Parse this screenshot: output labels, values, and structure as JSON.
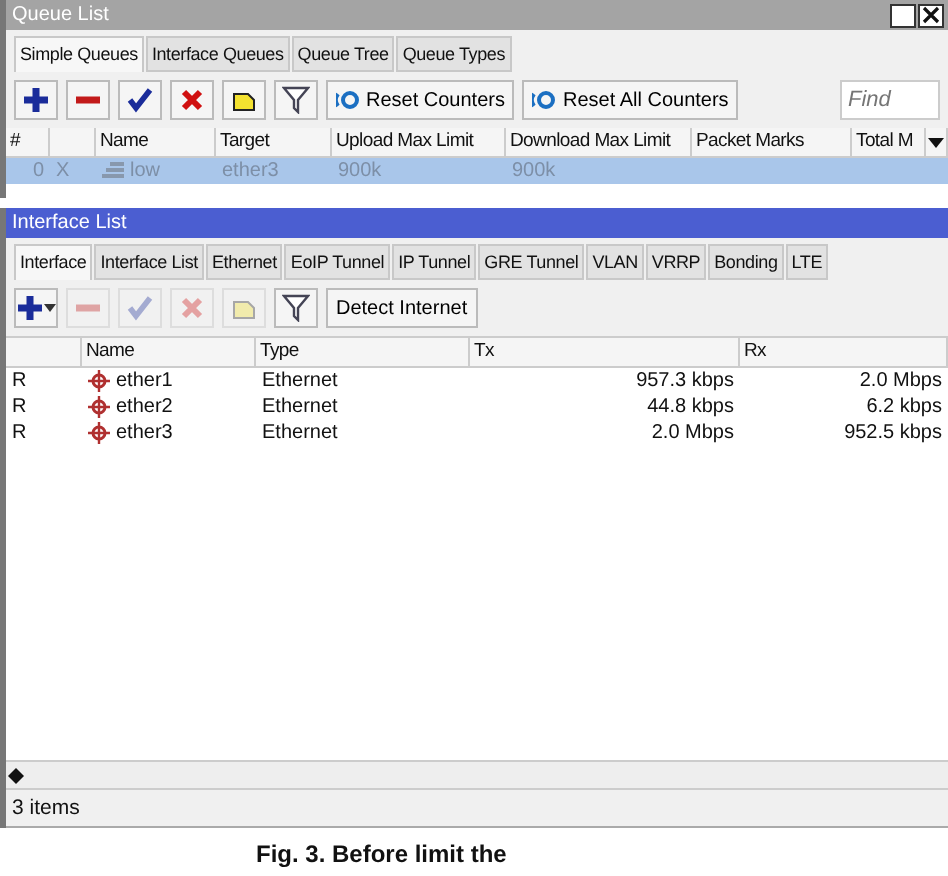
{
  "queue_list": {
    "title": "Queue List",
    "tabs": [
      {
        "label": "Simple Queues",
        "selected": true
      },
      {
        "label": "Interface Queues",
        "selected": false
      },
      {
        "label": "Queue Tree",
        "selected": false
      },
      {
        "label": "Queue Types",
        "selected": false
      }
    ],
    "tools": [
      {
        "kind": "add",
        "disabled": false
      },
      {
        "kind": "remove",
        "disabled": false
      },
      {
        "kind": "enable",
        "disabled": false
      },
      {
        "kind": "disable",
        "disabled": false
      },
      {
        "kind": "comment",
        "disabled": false
      },
      {
        "kind": "filter",
        "disabled": false
      }
    ],
    "buttons": [
      "Reset Counters",
      "Reset All Counters"
    ],
    "search": {
      "placeholder": "Find"
    },
    "columns": [
      "#",
      "Name",
      "Target",
      "Upload Max Limit",
      "Download Max Limit",
      "Packet Marks",
      "Total M"
    ],
    "rows": [
      {
        "number": "0",
        "flag": "X",
        "name": "low",
        "target": "ether3",
        "upload": "900k",
        "download": "900k",
        "selected": true,
        "disabled": true
      }
    ]
  },
  "interface_list": {
    "title": "Interface List",
    "tabs": [
      {
        "label": "Interface",
        "selected": true
      },
      {
        "label": "Interface List",
        "selected": false
      },
      {
        "label": "Ethernet",
        "selected": false
      },
      {
        "label": "EoIP Tunnel",
        "selected": false
      },
      {
        "label": "IP Tunnel",
        "selected": false
      },
      {
        "label": "GRE Tunnel",
        "selected": false
      },
      {
        "label": "VLAN",
        "selected": false
      },
      {
        "label": "VRRP",
        "selected": false
      },
      {
        "label": "Bonding",
        "selected": false
      },
      {
        "label": "LTE",
        "selected": false
      }
    ],
    "tools": [
      {
        "kind": "add",
        "disabled": false
      },
      {
        "kind": "remove",
        "disabled": true
      },
      {
        "kind": "enable",
        "disabled": true
      },
      {
        "kind": "disable",
        "disabled": true
      },
      {
        "kind": "comment",
        "disabled": true
      },
      {
        "kind": "filter",
        "disabled": false
      }
    ],
    "buttons": [
      "Detect Internet"
    ],
    "columns": [
      "Name",
      "Type",
      "Tx",
      "Rx"
    ],
    "rows": [
      {
        "flag": "R",
        "name": "ether1",
        "type": "Ethernet",
        "tx": "957.3 kbps",
        "rx": "2.0 Mbps"
      },
      {
        "flag": "R",
        "name": "ether2",
        "type": "Ethernet",
        "tx": "44.8 kbps",
        "rx": "6.2 kbps"
      },
      {
        "flag": "R",
        "name": "ether3",
        "type": "Ethernet",
        "tx": "2.0 Mbps",
        "rx": "952.5 kbps"
      }
    ],
    "status": "3 items"
  },
  "caption": "Fig. 3.  Before limit the"
}
